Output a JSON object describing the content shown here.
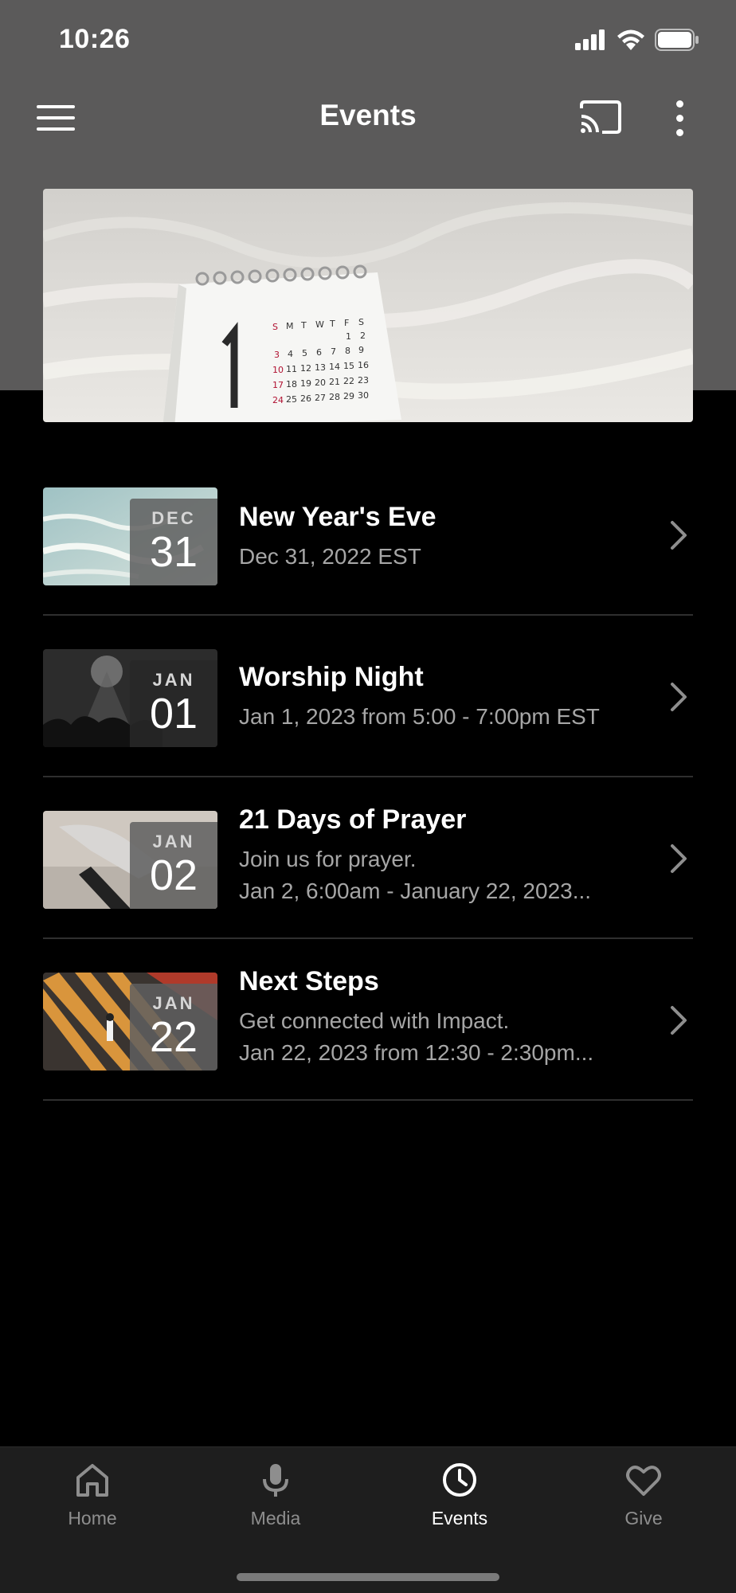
{
  "status_bar": {
    "time": "10:26"
  },
  "header": {
    "title": "Events",
    "menu_icon": "hamburger-menu-icon",
    "cast_icon": "cast-icon",
    "more_icon": "more-vertical-icon"
  },
  "events": [
    {
      "month": "DEC",
      "day": "31",
      "title": "New Year's Eve",
      "lines": [
        "Dec 31, 2022 EST"
      ]
    },
    {
      "month": "JAN",
      "day": "01",
      "title": "Worship Night",
      "lines": [
        "Jan 1, 2023 from 5:00 - 7:00pm EST"
      ]
    },
    {
      "month": "JAN",
      "day": "02",
      "title": "21 Days of Prayer",
      "lines": [
        "Join us for prayer.",
        "Jan 2, 6:00am - January 22, 2023..."
      ]
    },
    {
      "month": "JAN",
      "day": "22",
      "title": "Next Steps",
      "lines": [
        "Get connected with Impact.",
        "Jan 22, 2023 from 12:30 - 2:30pm..."
      ]
    }
  ],
  "tabs": [
    {
      "label": "Home",
      "icon": "home-icon"
    },
    {
      "label": "Media",
      "icon": "microphone-icon"
    },
    {
      "label": "Events",
      "icon": "clock-icon",
      "active": true
    },
    {
      "label": "Give",
      "icon": "heart-icon"
    }
  ],
  "colors": {
    "header_bg": "#5b5a5a",
    "page_bg": "#000000",
    "tab_bar_bg": "#1e1e1e",
    "muted_text": "#a6a6a6"
  }
}
